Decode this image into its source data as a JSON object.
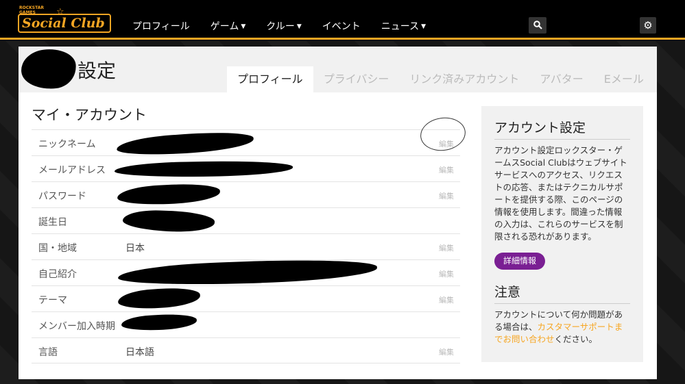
{
  "logo": {
    "top": "ROCKSTAR\nGAMES",
    "text": "Social Club"
  },
  "nav": {
    "items": [
      {
        "label": "プロフィール",
        "caret": false
      },
      {
        "label": "ゲーム",
        "caret": true
      },
      {
        "label": "クルー",
        "caret": true
      },
      {
        "label": "イベント",
        "caret": false
      },
      {
        "label": "ニュース",
        "caret": true
      }
    ]
  },
  "page": {
    "title": "設定"
  },
  "tabs": [
    {
      "label": "プロフィール",
      "active": true
    },
    {
      "label": "プライバシー",
      "active": false
    },
    {
      "label": "リンク済みアカウント",
      "active": false
    },
    {
      "label": "アバター",
      "active": false
    },
    {
      "label": "Eメール",
      "active": false
    }
  ],
  "account": {
    "title": "マイ・アカウント",
    "rows": [
      {
        "label": "ニックネーム",
        "value": "",
        "edit": "編集"
      },
      {
        "label": "メールアドレス",
        "value": "",
        "edit": "編集"
      },
      {
        "label": "パスワード",
        "value": "",
        "edit": "編集"
      },
      {
        "label": "誕生日",
        "value": "",
        "edit": ""
      },
      {
        "label": "国・地域",
        "value": "日本",
        "edit": "編集"
      },
      {
        "label": "自己紹介",
        "value": "",
        "edit": "編集"
      },
      {
        "label": "テーマ",
        "value": "",
        "edit": "編集"
      },
      {
        "label": "メンバー加入時期",
        "value": "",
        "edit": ""
      },
      {
        "label": "言語",
        "value": "日本語",
        "edit": "編集"
      }
    ]
  },
  "sidebar": {
    "settings_title": "アカウント設定",
    "settings_text": "アカウント設定ロックスター・ゲームスSocial Clubはウェブサイトサービスへのアクセス、リクエストの応答、またはテクニカルサポートを提供する際、このページの情報を使用します。間違った情報の入力は、これらのサービスを制限される恐れがあります。",
    "detail_button": "詳細情報",
    "notice_title": "注意",
    "notice_text": "アカウントについて何か問題がある場合は、",
    "notice_link": "カスタマーサポートまでお問い合わせ",
    "notice_tail": "ください。"
  },
  "colors": {
    "accent": "#f6a623",
    "button": "#7a1f93"
  },
  "icons": {
    "search": "search-icon",
    "settings": "gear-icon"
  }
}
